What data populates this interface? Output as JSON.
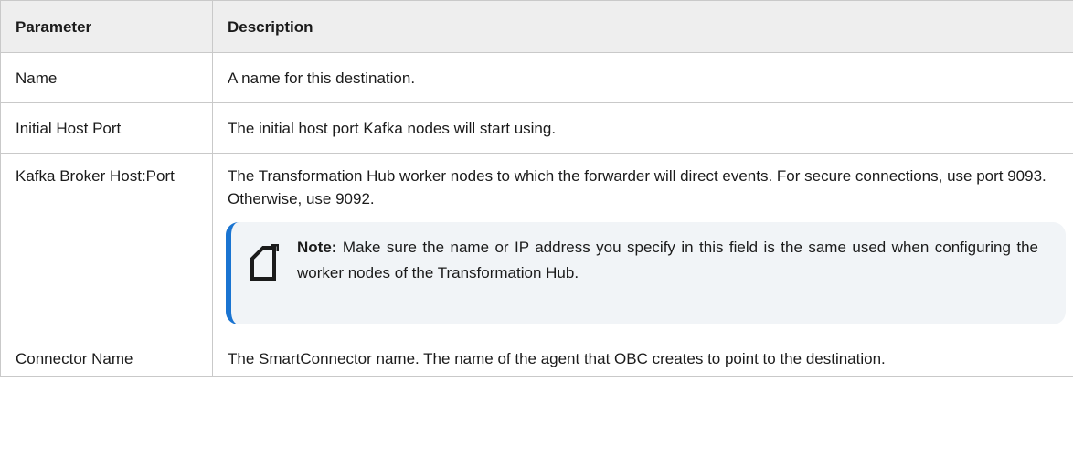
{
  "table": {
    "headers": {
      "parameter": "Parameter",
      "description": "Description"
    },
    "rows": [
      {
        "parameter": "Name",
        "description": "A name for this destination."
      },
      {
        "parameter": "Initial Host Port",
        "description": "The initial host port Kafka nodes will start using."
      },
      {
        "parameter": "Kafka Broker Host:Port",
        "description": "The Transformation Hub worker nodes to which the forwarder will direct events. For secure connections, use port 9093. Otherwise, use 9092.",
        "note": {
          "icon": "note-icon",
          "label": "Note:",
          "text": "Make sure the name or IP address you specify in this field is the same used when configuring the worker nodes of the Transformation Hub."
        }
      },
      {
        "parameter": "Connector Name",
        "description": "The SmartConnector name. The name of the agent that OBC creates to point to the destination."
      }
    ]
  },
  "colors": {
    "header_bg": "#eeeeee",
    "border": "#c9c9c9",
    "note_bg": "#f1f4f7",
    "note_accent": "#1a74d1"
  }
}
